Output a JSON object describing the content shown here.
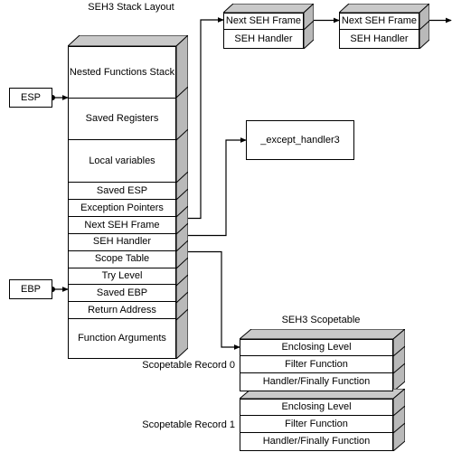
{
  "diagram": {
    "stack_title": "SEH3 Stack Layout",
    "scopetable_title": "SEH3 Scopetable"
  },
  "registers": [
    {
      "name": "ESP",
      "label": "ESP"
    },
    {
      "name": "EBP",
      "label": "EBP"
    }
  ],
  "stack": {
    "rows": [
      {
        "label": "Nested Functions Stack",
        "tall": true
      },
      {
        "label": "Saved Registers",
        "tall": true
      },
      {
        "label": "Local variables",
        "tall": true
      },
      {
        "label": "Saved ESP"
      },
      {
        "label": "Exception Pointers"
      },
      {
        "label": "Next SEH Frame"
      },
      {
        "label": "SEH Handler"
      },
      {
        "label": "Scope Table"
      },
      {
        "label": "Try Level"
      },
      {
        "label": "Saved EBP"
      },
      {
        "label": "Return Address"
      },
      {
        "label": "Function Arguments",
        "tall": true
      }
    ]
  },
  "seh_frames": [
    {
      "rows": [
        "Next SEH Frame",
        "SEH Handler"
      ]
    },
    {
      "rows": [
        "Next SEH Frame",
        "SEH Handler"
      ]
    }
  ],
  "handler_box": {
    "label": "_except_handler3"
  },
  "scopetable": {
    "records": [
      {
        "caption": "Scopetable Record 0",
        "rows": [
          "Enclosing Level",
          "Filter Function",
          "Handler/Finally Function"
        ]
      },
      {
        "caption": "Scopetable Record 1",
        "rows": [
          "Enclosing Level",
          "Filter Function",
          "Handler/Finally Function"
        ]
      }
    ]
  },
  "colors": {
    "outline": "#000000",
    "face": "#ffffff",
    "side_shade": "#b9b9b9",
    "top_shade": "#c9c9c9",
    "connector": "#000000"
  }
}
